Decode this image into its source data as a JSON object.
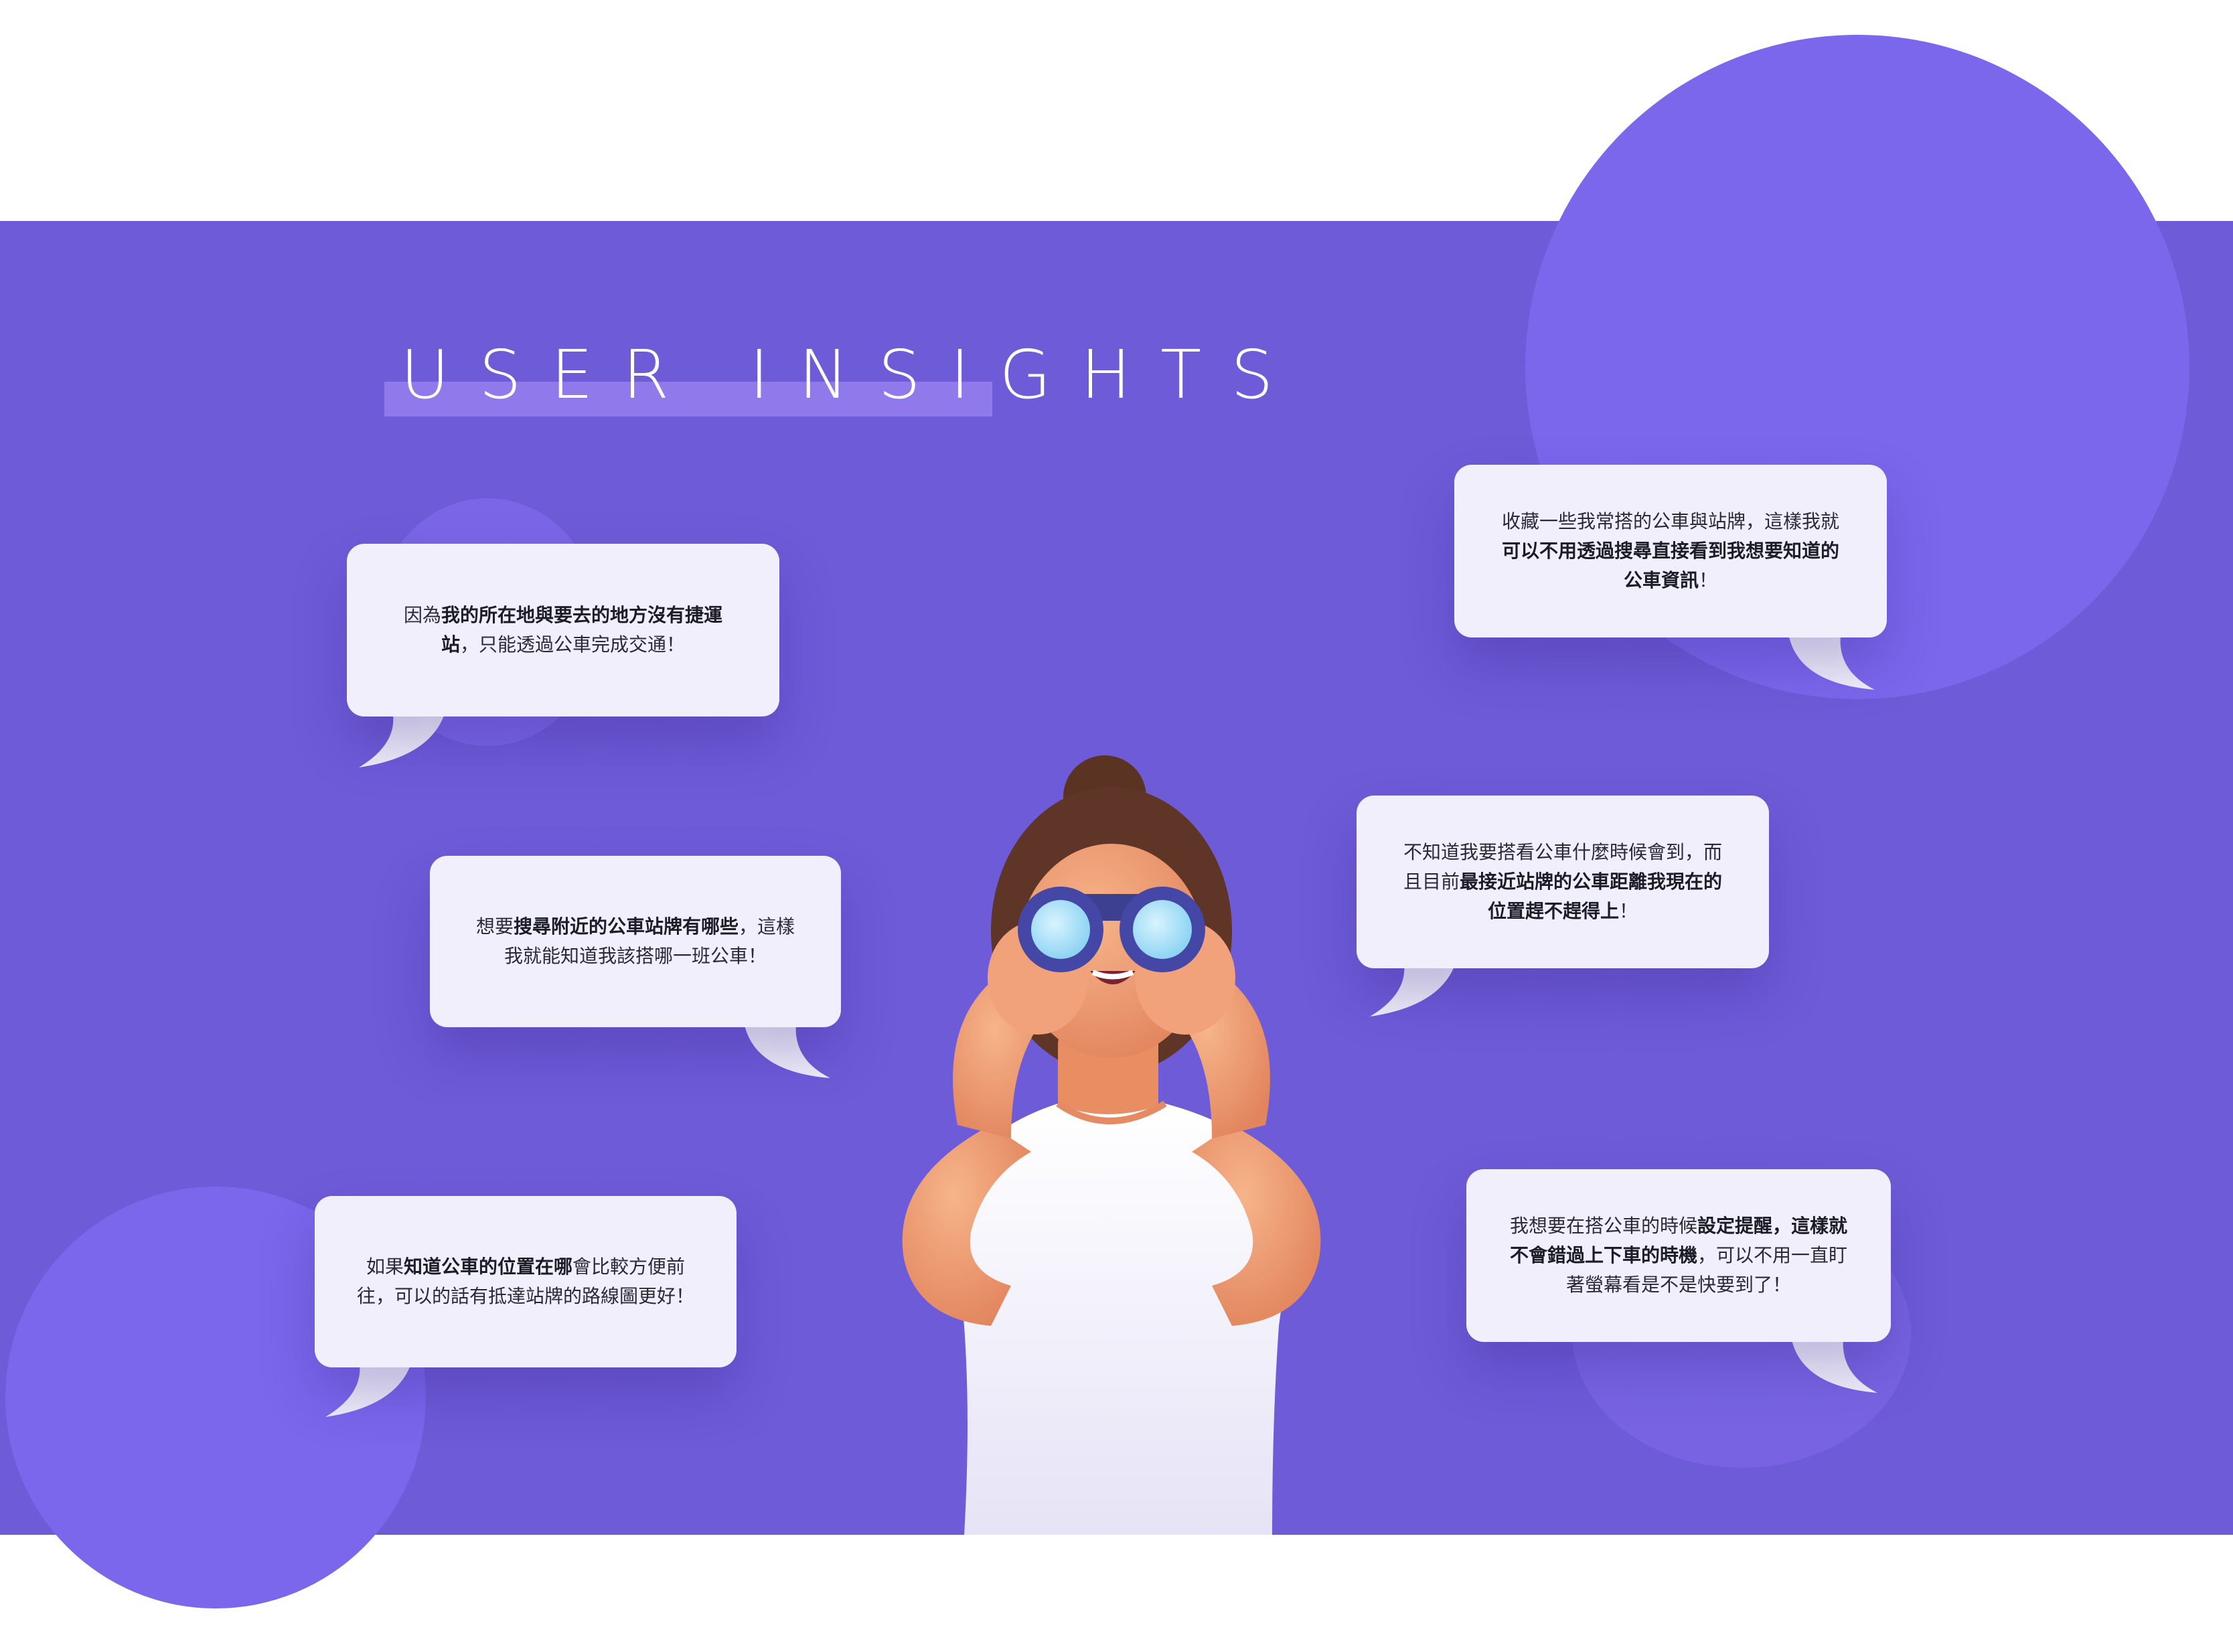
{
  "section": {
    "title": "USER INSIGHTS"
  },
  "bubbles": [
    {
      "pre": "因為",
      "bold": "我的所在地與要去的地方沒有捷運站",
      "post": "，只能透過公車完成交通！"
    },
    {
      "pre": "想要",
      "bold": "搜尋附近的公車站牌有哪些",
      "post": "，這樣我就能知道我該搭哪一班公車！"
    },
    {
      "pre": "如果",
      "bold": "知道公車的位置在哪",
      "post": "會比較方便前往，可以的話有抵達站牌的路線圖更好！"
    },
    {
      "pre": "收藏一些我常搭的公車與站牌，這樣我就",
      "bold": "可以不用透過搜尋直接看到我想要知道的公車資訊",
      "post": "！"
    },
    {
      "pre": "不知道我要搭看公車什麼時候會到，而且目前",
      "bold": "最接近站牌的公車距離我現在的位置趕不趕得上",
      "post": "！"
    },
    {
      "pre": "我想要在搭公車的時候",
      "bold": "設定提醒，這樣就不會錯過上下車的時機",
      "post": "，可以不用一直盯著螢幕看是不是快要到了！"
    }
  ],
  "colors": {
    "band": "#6e5bd8",
    "circle": "#7b67ec",
    "title_underline": "#9079ea",
    "bubble_bg": "#f1effb"
  },
  "illustration": "woman-with-binoculars"
}
